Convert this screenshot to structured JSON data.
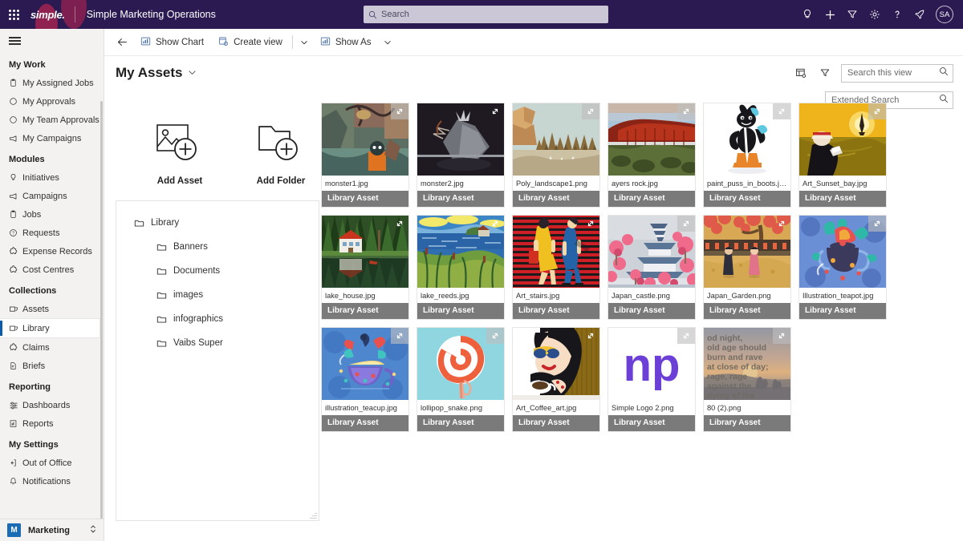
{
  "header": {
    "brand": "simple.",
    "app_title": "Simple Marketing Operations",
    "search_placeholder": "Search",
    "search_value": "",
    "icons": [
      {
        "name": "lightbulb-icon",
        "label": "Ideas"
      },
      {
        "name": "plus-icon",
        "label": "New"
      },
      {
        "name": "filter-icon",
        "label": "Filter"
      },
      {
        "name": "gear-icon",
        "label": "Settings"
      },
      {
        "name": "help-icon",
        "label": "Help"
      },
      {
        "name": "rocket-icon",
        "label": "What's new"
      }
    ],
    "avatar_initials": "SA",
    "bar_color": "#2b1a52"
  },
  "sidebar": {
    "groups": [
      {
        "title": "My Work",
        "items": [
          {
            "label": "My Assigned Jobs",
            "icon": "clipboard-icon"
          },
          {
            "label": "My Approvals",
            "icon": "circle-icon"
          },
          {
            "label": "My Team Approvals",
            "icon": "circle-icon"
          },
          {
            "label": "My Campaigns",
            "icon": "megaphone-icon"
          }
        ]
      },
      {
        "title": "Modules",
        "items": [
          {
            "label": "Initiatives",
            "icon": "lightbulb-icon"
          },
          {
            "label": "Campaigns",
            "icon": "megaphone-icon"
          },
          {
            "label": "Jobs",
            "icon": "clipboard-icon"
          },
          {
            "label": "Requests",
            "icon": "question-circle-icon"
          },
          {
            "label": "Expense Records",
            "icon": "puzzle-icon"
          },
          {
            "label": "Cost Centres",
            "icon": "puzzle-icon"
          }
        ]
      },
      {
        "title": "Collections",
        "items": [
          {
            "label": "Assets",
            "icon": "collection-icon"
          },
          {
            "label": "Library",
            "icon": "collection-icon",
            "selected": true
          },
          {
            "label": "Claims",
            "icon": "puzzle-icon"
          },
          {
            "label": "Briefs",
            "icon": "document-icon"
          }
        ]
      },
      {
        "title": "Reporting",
        "items": [
          {
            "label": "Dashboards",
            "icon": "dashboard-icon"
          },
          {
            "label": "Reports",
            "icon": "report-icon"
          }
        ]
      },
      {
        "title": "My Settings",
        "items": [
          {
            "label": "Out of Office",
            "icon": "exit-icon"
          },
          {
            "label": "Notifications",
            "icon": "bell-icon"
          }
        ]
      }
    ],
    "footer": {
      "initial": "M",
      "label": "Marketing",
      "accent": "#1b6cb5"
    },
    "selected_accent": "#0b5cab"
  },
  "command_bar": {
    "back": "back-arrow",
    "buttons": [
      {
        "label": "Show Chart",
        "icon": "chart-icon"
      },
      {
        "label": "Create view",
        "icon": "create-view-icon"
      }
    ],
    "show_as_label": "Show As",
    "show_as_icon": "chart-icon"
  },
  "view_header": {
    "title": "My Assets",
    "search_this_view_placeholder": "Search this view",
    "search_this_view_value": "",
    "extended_search_placeholder": "Extended Search",
    "extended_search_value": "",
    "icons": [
      {
        "name": "edit-columns-icon"
      },
      {
        "name": "filter-icon"
      }
    ]
  },
  "left_pane": {
    "add_asset_label": "Add Asset",
    "add_folder_label": "Add Folder",
    "tree": [
      {
        "label": "Library",
        "level": 0
      },
      {
        "label": "Banners",
        "level": 1
      },
      {
        "label": "Documents",
        "level": 1
      },
      {
        "label": "images",
        "level": 1
      },
      {
        "label": "infographics",
        "level": 1
      },
      {
        "label": "Vaibs Super",
        "level": 1
      }
    ]
  },
  "assets": {
    "tag_label": "Library Asset",
    "tag_color": "#7a7a7a",
    "items": [
      {
        "filename": "monster1.jpg",
        "art": "monster1"
      },
      {
        "filename": "monster2.jpg",
        "art": "monster2"
      },
      {
        "filename": "Poly_landscape1.png",
        "art": "poly"
      },
      {
        "filename": "ayers rock.jpg",
        "art": "ayers"
      },
      {
        "filename": "paint_puss_in_boots.jpg",
        "art": "puss"
      },
      {
        "filename": "Art_Sunset_bay.jpg",
        "art": "sunsetbay"
      },
      {
        "filename": "lake_house.jpg",
        "art": "lakehouse"
      },
      {
        "filename": "lake_reeds.jpg",
        "art": "lakereeds"
      },
      {
        "filename": "Art_stairs.jpg",
        "art": "stairs"
      },
      {
        "filename": "Japan_castle.png",
        "art": "japancastle"
      },
      {
        "filename": "Japan_Garden.png",
        "art": "japangarden"
      },
      {
        "filename": "Illustration_teapot.jpg",
        "art": "teapot"
      },
      {
        "filename": "illustration_teacup.jpg",
        "art": "teacup"
      },
      {
        "filename": "lollipop_snake.png",
        "art": "lollipop"
      },
      {
        "filename": "Art_Coffee_art.jpg",
        "art": "coffee"
      },
      {
        "filename": "Simple Logo 2.png",
        "art": "nplogo",
        "logo_text": "np"
      },
      {
        "filename": "80 (2).png",
        "art": "poem",
        "poem_text": "od night, old age should burn and rave at close of day; rage, rage against the dying of the"
      }
    ]
  }
}
